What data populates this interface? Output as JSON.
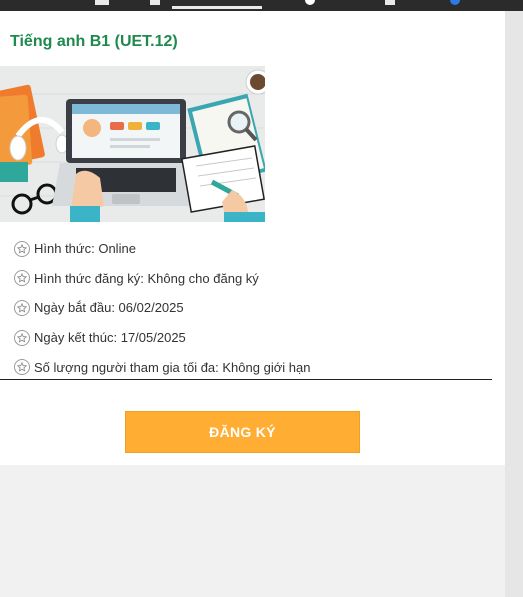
{
  "course": {
    "title": "Tiếng anh B1 (UET.12)",
    "image": "online-learning-illustration"
  },
  "info": [
    {
      "icon": "star-icon",
      "label": " Hình thức: Online"
    },
    {
      "icon": "star-icon",
      "label": "Hình thức đăng ký: Không cho đăng ký"
    },
    {
      "icon": "star-icon",
      "label": "Ngày bắt đầu: 06/02/2025"
    },
    {
      "icon": "star-icon",
      "label": "Ngày kết thúc: 17/05/2025"
    },
    {
      "icon": "star-icon",
      "label": "Số lượng người tham gia tối đa: Không giới hạn"
    }
  ],
  "actions": {
    "register_label": "ĐĂNG KÝ"
  },
  "colors": {
    "title": "#1f8a4d",
    "button": "#ffad33",
    "page_bg": "#f1f1f1"
  }
}
